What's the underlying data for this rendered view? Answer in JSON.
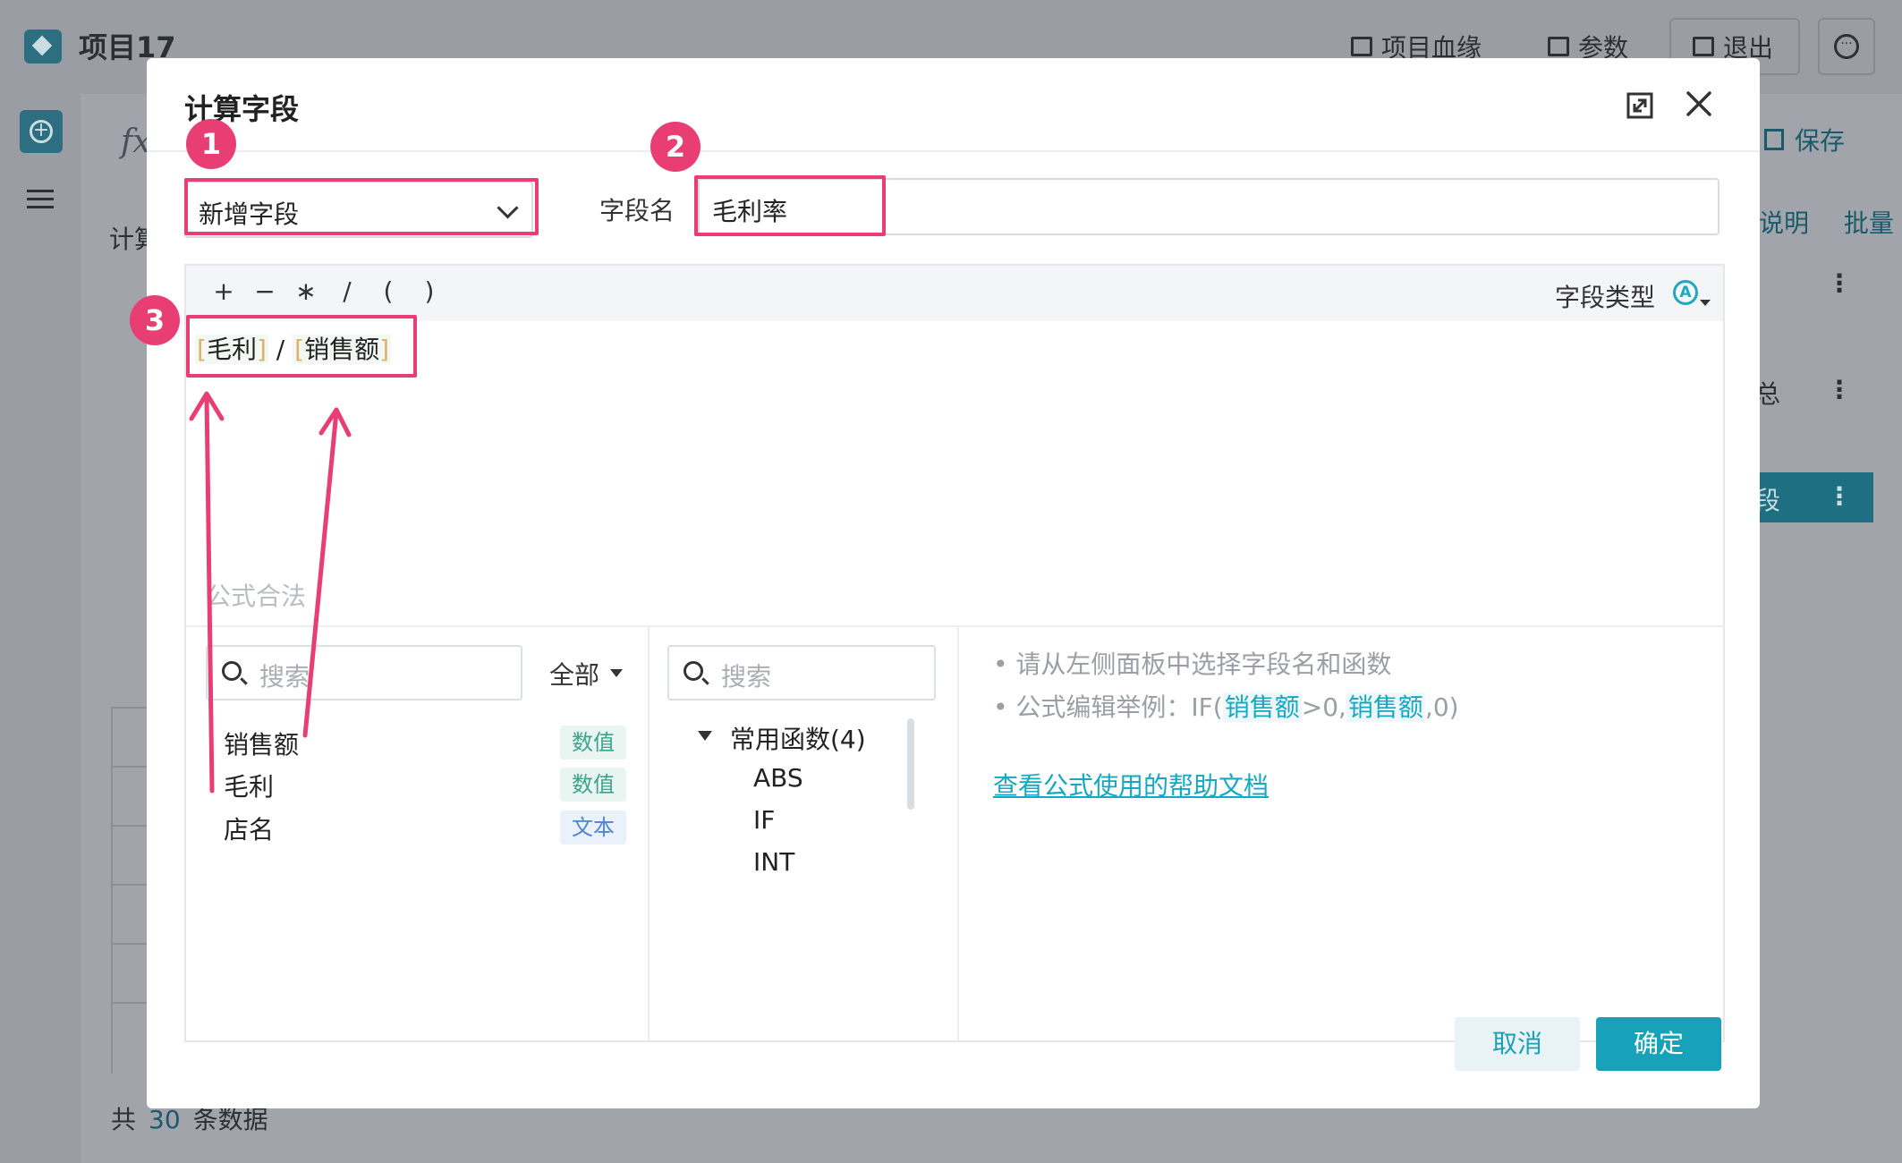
{
  "app": {
    "title": "项目17",
    "top_buttons": [
      "项目血缘",
      "参数",
      "退出"
    ],
    "bg_save": "保存",
    "bg_links": [
      "说明",
      "批量"
    ],
    "bg_calc_label": "计算",
    "bg_rows": [
      "总",
      "段"
    ],
    "footer_prefix": "共",
    "footer_count": "30",
    "footer_suffix": "条数据"
  },
  "dialog": {
    "title": "计算字段",
    "mode_select": "新增字段",
    "field_name_label": "字段名",
    "field_name_value": "毛利率",
    "operators": [
      "+",
      "−",
      "∗",
      "/",
      "(",
      ")"
    ],
    "field_type_label": "字段类型",
    "field_type_icon": "A",
    "formula": {
      "open": "[",
      "close": "]",
      "token1": "毛利",
      "operator": "/",
      "token2": "销售额"
    },
    "validity": "公式合法",
    "field_search_placeholder": "搜索",
    "field_filter": "全部",
    "fields": [
      {
        "name": "销售额",
        "type": "数值"
      },
      {
        "name": "毛利",
        "type": "数值"
      },
      {
        "name": "店名",
        "type": "文本"
      }
    ],
    "function_search_placeholder": "搜索",
    "function_group": "常用函数(4)",
    "functions": [
      "ABS",
      "IF",
      "INT"
    ],
    "help": {
      "tip1": "• 请从左侧面板中选择字段名和函数",
      "tip2_prefix": "• 公式编辑举例：IF(",
      "tip2_field": "销售额",
      "tip2_mid": ">0,",
      "tip2_suffix": ",0)",
      "link": "查看公式使用的帮助文档"
    },
    "cancel": "取消",
    "confirm": "确定"
  },
  "annotations": [
    "1",
    "2",
    "3"
  ],
  "colors": {
    "accent": "#17a2ba",
    "annotation": "#e83e74"
  }
}
